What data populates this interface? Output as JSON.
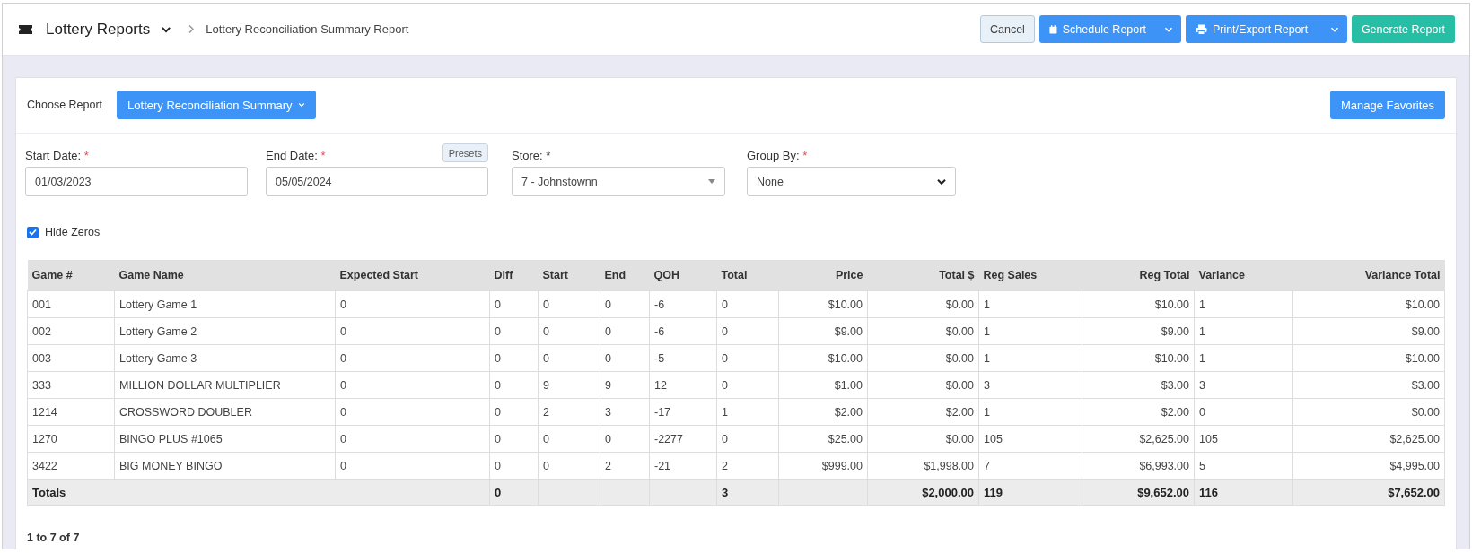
{
  "header": {
    "app_title": "Lottery Reports",
    "breadcrumb": "Lottery Reconciliation Summary Report",
    "buttons": [
      {
        "label": "Cancel",
        "kind": "secondary"
      },
      {
        "label": "Schedule Report",
        "kind": "split"
      },
      {
        "label": "Print/Export Report",
        "kind": "split"
      },
      {
        "label": "Generate Report",
        "kind": "success"
      }
    ]
  },
  "report_picker": {
    "label": "Choose Report",
    "value": "Lottery Reconciliation Summary",
    "manage_button": "Manage Favorites"
  },
  "fields": [
    {
      "label": "Start Date:",
      "required_mark": "*",
      "required": true,
      "kind": "date",
      "value": "01/03/2023"
    },
    {
      "label": "End Date:",
      "required_mark": "*",
      "required": true,
      "kind": "date",
      "value": "05/05/2024",
      "presets": "Presets"
    },
    {
      "label": "Store:",
      "required_mark": "*",
      "required": false,
      "kind": "combo",
      "value": "7 - Johnstownn"
    },
    {
      "label": "Group By:",
      "required_mark": "*",
      "required": true,
      "kind": "select",
      "value": "None"
    }
  ],
  "hide_zeros": {
    "label": "Hide Zeros",
    "checked": true
  },
  "table": {
    "columns": [
      {
        "label": "Game #",
        "kind": "text"
      },
      {
        "label": "Game Name",
        "kind": "text"
      },
      {
        "label": "Expected Start",
        "kind": "text"
      },
      {
        "label": "Diff",
        "kind": "text"
      },
      {
        "label": "Start",
        "kind": "text"
      },
      {
        "label": "End",
        "kind": "text"
      },
      {
        "label": "QOH",
        "kind": "text"
      },
      {
        "label": "Total",
        "kind": "text"
      },
      {
        "label": "Price",
        "kind": "currency"
      },
      {
        "label": "Total $",
        "kind": "currency"
      },
      {
        "label": "Reg Sales",
        "kind": "text"
      },
      {
        "label": "Reg Total",
        "kind": "currency"
      },
      {
        "label": "Variance",
        "kind": "text"
      },
      {
        "label": "Variance Total",
        "kind": "currency"
      }
    ],
    "rows": [
      [
        "001",
        "Lottery Game 1",
        "0",
        "0",
        "0",
        "0",
        "-6",
        "0",
        "$10.00",
        "$0.00",
        "1",
        "$10.00",
        "1",
        "$10.00"
      ],
      [
        "002",
        "Lottery Game 2",
        "0",
        "0",
        "0",
        "0",
        "-6",
        "0",
        "$9.00",
        "$0.00",
        "1",
        "$9.00",
        "1",
        "$9.00"
      ],
      [
        "003",
        "Lottery Game 3",
        "0",
        "0",
        "0",
        "0",
        "-5",
        "0",
        "$10.00",
        "$0.00",
        "1",
        "$10.00",
        "1",
        "$10.00"
      ],
      [
        "333",
        "MILLION DOLLAR MULTIPLIER",
        "0",
        "0",
        "9",
        "9",
        "12",
        "0",
        "$1.00",
        "$0.00",
        "3",
        "$3.00",
        "3",
        "$3.00"
      ],
      [
        "1214",
        "CROSSWORD DOUBLER",
        "0",
        "0",
        "2",
        "3",
        "-17",
        "1",
        "$2.00",
        "$2.00",
        "1",
        "$2.00",
        "0",
        "$0.00"
      ],
      [
        "1270",
        "BINGO PLUS #1065",
        "0",
        "0",
        "0",
        "0",
        "-2277",
        "0",
        "$25.00",
        "$0.00",
        "105",
        "$2,625.00",
        "105",
        "$2,625.00"
      ],
      [
        "3422",
        "BIG MONEY BINGO",
        "0",
        "0",
        "0",
        "2",
        "-21",
        "2",
        "$999.00",
        "$1,998.00",
        "7",
        "$6,993.00",
        "5",
        "$4,995.00"
      ]
    ],
    "totals": {
      "label": "Totals",
      "cells": [
        "0",
        null,
        null,
        null,
        "3",
        null,
        "$2,000.00",
        "119",
        "$9,652.00",
        "116",
        "$7,652.00"
      ]
    }
  },
  "pagination": "1 to 7 of 7"
}
